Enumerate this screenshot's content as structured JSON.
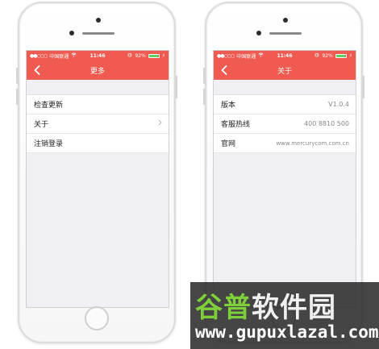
{
  "colors": {
    "accent": "#ef5b50",
    "screen_bg": "#efeff4",
    "battery_green": "#5ed35e"
  },
  "status_bar": {
    "signal": "●●○○○",
    "carrier": "中国联通",
    "wifi_icon": "wifi-icon",
    "time": "11:46",
    "alarm_icon": "alarm-icon",
    "battery": "92%",
    "battery_level": 0.92,
    "charging_icon": "lightning-icon"
  },
  "left_screen": {
    "title": "更多",
    "back_icon": "chevron-left-icon",
    "items": [
      {
        "label": "检查更新"
      },
      {
        "label": "关于",
        "chevron_icon": "chevron-right-icon"
      },
      {
        "label": "注销登录"
      }
    ]
  },
  "right_screen": {
    "title": "关于",
    "back_icon": "chevron-left-icon",
    "items": [
      {
        "label": "版本",
        "value": "V1.0.4"
      },
      {
        "label": "客服热线",
        "value": "400 8810 500"
      },
      {
        "label": "官网",
        "value": "www.mercurycom.com.cn"
      }
    ]
  },
  "watermark": {
    "title_part1": "谷普",
    "title_part2": "软件园",
    "url": "www.gupuxlazal.com"
  }
}
